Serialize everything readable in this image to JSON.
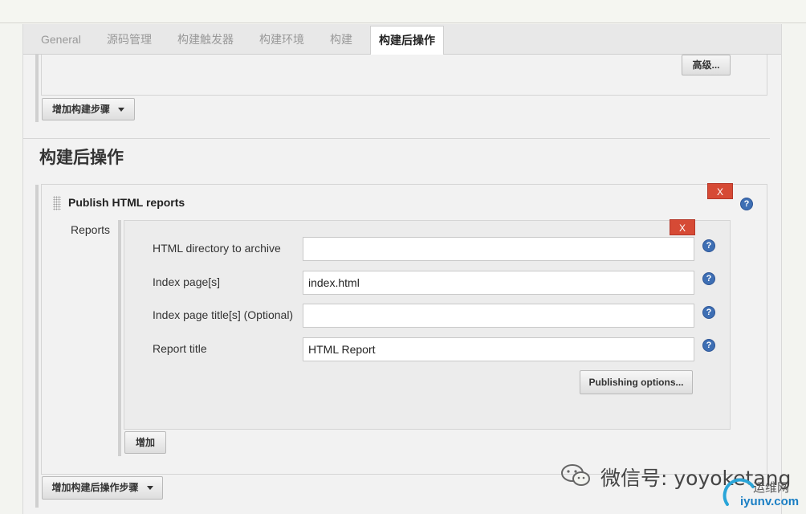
{
  "tabs": [
    {
      "label": "General",
      "active": false
    },
    {
      "label": "源码管理",
      "active": false
    },
    {
      "label": "构建触发器",
      "active": false
    },
    {
      "label": "构建环境",
      "active": false
    },
    {
      "label": "构建",
      "active": false
    },
    {
      "label": "构建后操作",
      "active": true
    }
  ],
  "build": {
    "advanced_label": "高级...",
    "add_build_step_label": "增加构建步骤"
  },
  "post_build": {
    "section_title": "构建后操作",
    "publisher_title": "Publish HTML reports",
    "delete_label": "X",
    "reports_label": "Reports",
    "report_delete_label": "X",
    "fields": [
      {
        "label": "HTML directory to archive",
        "value": ""
      },
      {
        "label": "Index page[s]",
        "value": "index.html"
      },
      {
        "label": "Index page title[s] (Optional)",
        "value": ""
      },
      {
        "label": "Report title",
        "value": "HTML Report"
      }
    ],
    "publishing_options_label": "Publishing options...",
    "add_report_label": "增加",
    "add_post_build_step_label": "增加构建后操作步骤"
  },
  "watermark": {
    "wechat_text": "微信号: yoyoketang",
    "site_name": "运维网",
    "site_url": "iyunv.com"
  },
  "colors": {
    "delete_red": "#d64a35",
    "help_blue": "#3e6fb4"
  }
}
